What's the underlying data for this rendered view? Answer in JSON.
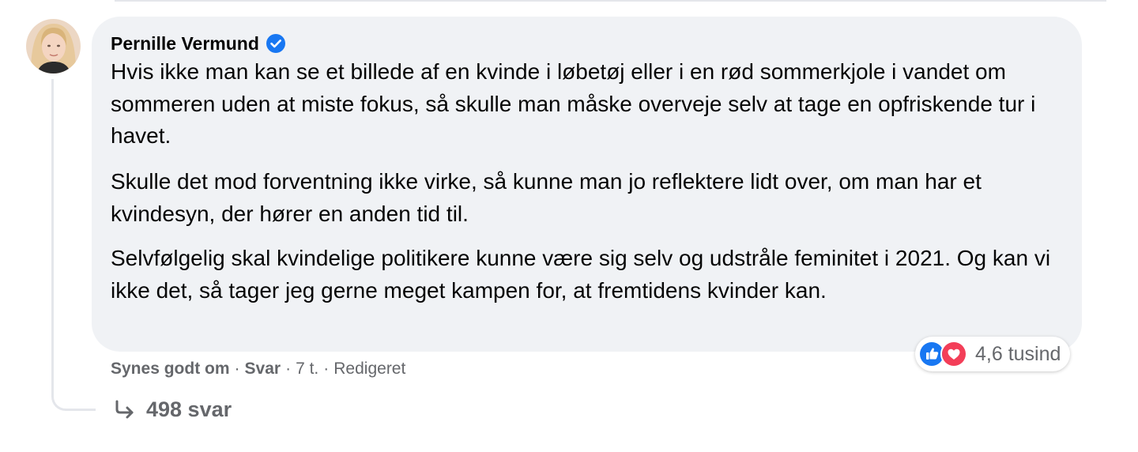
{
  "comment": {
    "author": "Pernille Vermund",
    "verified_icon": "verified-badge-icon",
    "paragraphs": [
      "Hvis ikke man kan se et billede af en kvinde i løbetøj eller i en rød sommerkjole i vandet om sommeren uden at miste fokus, så skulle man måske overveje selv at tage en opfriskende tur i havet.",
      "Skulle det mod forventning ikke virke, så kunne man jo reflektere lidt over, om man har et kvindesyn, der hører en anden tid til.",
      "Selvfølgelig skal kvindelige politikere kunne være sig selv og udstråle feminitet i 2021. Og kan vi ikke det, så tager jeg gerne meget kampen for, at fremtidens kvinder kan."
    ],
    "reactions": {
      "icons": [
        "like-icon",
        "love-icon"
      ],
      "count": "4,6 tusind"
    },
    "actions": {
      "like": "Synes godt om",
      "reply": "Svar",
      "time": "7 t.",
      "edited": "Redigeret"
    },
    "replies": {
      "label": "498 svar"
    }
  },
  "colors": {
    "bubble": "#f0f2f5",
    "text": "#050505",
    "secondary": "#65676b",
    "verified": "#1877f2",
    "like": "#1877f2",
    "love": "#f33e58"
  }
}
